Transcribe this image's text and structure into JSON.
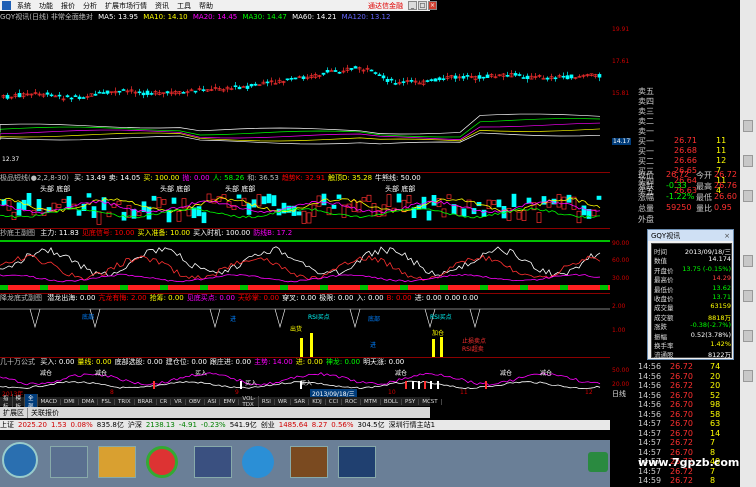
{
  "menu": {
    "items": [
      "系统",
      "功能",
      "报价",
      "分析",
      "扩展市场行情",
      "资讯",
      "工具",
      "帮助"
    ],
    "brand": "通达信金融"
  },
  "window_buttons": [
    "_",
    "□",
    "×"
  ],
  "main_title": {
    "text": "GQY视讯(日线) 非常全面绝对",
    "ma": [
      {
        "label": "MA5: 13.95",
        "color": "#ffffff"
      },
      {
        "label": "MA10: 14.10",
        "color": "#ffff00"
      },
      {
        "label": "MA20: 14.45",
        "color": "#ff00ff"
      },
      {
        "label": "MA30: 14.47",
        "color": "#00ff00"
      },
      {
        "label": "MA60: 14.21",
        "color": "#ffffff"
      },
      {
        "label": "MA120: 13.12",
        "color": "#4040ff"
      }
    ]
  },
  "price_axis": [
    "19.91",
    "17.61",
    "15.81",
    "14.17",
    "12.37"
  ],
  "panel2": {
    "title": "极品短线(●2,2,8-30)",
    "items": [
      {
        "label": "买: 13.49",
        "color": "#ffffff"
      },
      {
        "label": "卖: 14.05",
        "color": "#ffffff"
      },
      {
        "label": "买: 100.00",
        "color": "#ffff00"
      },
      {
        "label": "抛: 0.00",
        "color": "#ff00ff"
      },
      {
        "label": "人: 58.26",
        "color": "#00ff00"
      },
      {
        "label": "和: 36.53",
        "color": "#c0c0c0"
      },
      {
        "label": "趋势K: 32.91",
        "color": "#ff0000"
      },
      {
        "label": "触顶D: 35.28",
        "color": "#ffff00"
      },
      {
        "label": "牛熊线: 50.00",
        "color": "#ffffff"
      }
    ],
    "labels": [
      "头部 底部",
      "头部 底部",
      "头部 底部",
      "头部 底部"
    ],
    "axis": [
      "",
      "",
      ""
    ]
  },
  "panel3": {
    "title": "抄底王副图",
    "items": [
      {
        "label": "主力: 11.83",
        "color": "#ffffff"
      },
      {
        "label": "见底信号: 10.00",
        "color": "#ff0000"
      },
      {
        "label": "买入准备: 10.00",
        "color": "#ffff00"
      },
      {
        "label": "买入时机: 100.00",
        "color": "#ffffff"
      },
      {
        "label": "防线B: 17.2",
        "color": "#ff00ff"
      }
    ],
    "axis": [
      "90.00",
      "60.00",
      "30.00"
    ]
  },
  "panel4": {
    "title": "降龙底式副图",
    "items": [
      {
        "label": "潜龙出海: 0.00",
        "color": "#ffffff"
      },
      {
        "label": "亢龙有悔: 2.00",
        "color": "#ff0000"
      },
      {
        "label": "抢筹: 0.00",
        "color": "#ffff00"
      },
      {
        "label": "见底买点: 0.00",
        "color": "#ff00ff"
      },
      {
        "label": "天砂掌: 0.00",
        "color": "#ff0000"
      },
      {
        "label": "穿叉: 0.00",
        "color": "#ffffff"
      },
      {
        "label": "极限: 0.00",
        "color": "#ffffff"
      },
      {
        "label": "入: 0.00",
        "color": "#ffffff"
      },
      {
        "label": "B: 0.00",
        "color": "#ff0000"
      },
      {
        "label": "进: 0.00",
        "color": "#ffffff"
      },
      {
        "label": "0.00 0.00",
        "color": "#ffffff"
      }
    ],
    "labels": [
      "RSI买点",
      "RSI买点",
      "出货",
      "底部",
      "进",
      "底部",
      "加仓",
      "进",
      "RSI超卖",
      "止损卖点"
    ],
    "axis": [
      "2.00",
      "1.00"
    ]
  },
  "panel5": {
    "title": "几十万公式",
    "items": [
      {
        "label": "买入: 0.00",
        "color": "#ffffff"
      },
      {
        "label": "量线: 0.00",
        "color": "#ffff00"
      },
      {
        "label": "底部选股: 0.00",
        "color": "#ffffff"
      },
      {
        "label": "建仓位: 0.00",
        "color": "#ffffff"
      },
      {
        "label": "跟庄进: 0.00",
        "color": "#ffffff"
      },
      {
        "label": "主势: 14.00",
        "color": "#ff00ff"
      },
      {
        "label": "进: 0.00",
        "color": "#ffff00"
      },
      {
        "label": "神龙: 0.00",
        "color": "#00ff00"
      },
      {
        "label": "明天涨: 0.00",
        "color": "#ffffff"
      }
    ],
    "labels": [
      "减仓",
      "减仓",
      "买入",
      "减仓",
      "买入",
      "买入",
      "减仓",
      "减仓"
    ],
    "axis": [
      "50.00",
      "20.00"
    ]
  },
  "date_bar": {
    "year": "2013年",
    "marks": [
      "8",
      "9",
      "10",
      "11",
      "12"
    ],
    "current_date": "2013/09/18/三",
    "period": "日线"
  },
  "indicator_tabs": [
    "指标",
    "模板",
    "全部",
    "MACD",
    "DMI",
    "DMA",
    "FSL",
    "TRIX",
    "BRAR",
    "CR",
    "VR",
    "OBV",
    "ASI",
    "EMV",
    "VOL-TDX",
    "RSI",
    "WR",
    "SAR",
    "KDJ",
    "CCI",
    "ROC",
    "MTM",
    "BOLL",
    "PSY",
    "MCST"
  ],
  "sub_tabs": [
    "扩展区",
    "关联报价"
  ],
  "status_bar": [
    {
      "label": "上证",
      "color": "#000000"
    },
    {
      "label": "2025.20",
      "color": "#d00000"
    },
    {
      "label": "1.53",
      "color": "#d00000"
    },
    {
      "label": "0.08%",
      "color": "#d00000"
    },
    {
      "label": "835.8亿",
      "color": "#000000"
    },
    {
      "label": "沪深",
      "color": "#000000"
    },
    {
      "label": "2138.13",
      "color": "#008000"
    },
    {
      "label": "-4.91",
      "color": "#008000"
    },
    {
      "label": "-0.23%",
      "color": "#008000"
    },
    {
      "label": "541.9亿",
      "color": "#000000"
    },
    {
      "label": "创业",
      "color": "#000000"
    },
    {
      "label": "1485.64",
      "color": "#d00000"
    },
    {
      "label": "8.27",
      "color": "#d00000"
    },
    {
      "label": "0.56%",
      "color": "#d00000"
    },
    {
      "label": "304.5亿",
      "color": "#000000"
    },
    {
      "label": "深圳行情主站1",
      "color": "#000000"
    }
  ],
  "order_book": [
    {
      "label": "卖五",
      "price": "",
      "vol": ""
    },
    {
      "label": "卖四",
      "price": "",
      "vol": ""
    },
    {
      "label": "卖三",
      "price": "",
      "vol": ""
    },
    {
      "label": "卖二",
      "price": "",
      "vol": ""
    },
    {
      "label": "卖一",
      "price": "",
      "vol": ""
    },
    {
      "label": "买一",
      "price": "26.68",
      "vol": "11"
    },
    {
      "label": "买二",
      "price": "26.66",
      "vol": "12"
    },
    {
      "label": "买三",
      "price": "26.65",
      "vol": "7"
    },
    {
      "label": "买四",
      "price": "26.64",
      "vol": "11"
    },
    {
      "label": "买五",
      "price": "26.63",
      "vol": "4"
    }
  ],
  "order_book_first": {
    "label": "买一",
    "price": "26.71",
    "vol": "11"
  },
  "summary": [
    {
      "label": "现价",
      "value": "26.72",
      "label2": "今开",
      "value2": "26.72"
    },
    {
      "label": "涨跌",
      "value": "-0.33",
      "label2": "最高",
      "value2": "26.76"
    },
    {
      "label": "涨幅",
      "value": "-1.22%",
      "label2": "最低",
      "value2": "26.60"
    },
    {
      "label": "总量",
      "value": "59250",
      "label2": "量比",
      "value2": "0.95"
    },
    {
      "label": "外盘",
      "value": "",
      "label2": "",
      "value2": ""
    }
  ],
  "ticks": [
    {
      "time": "14:56",
      "price": "26.72",
      "vol": "74"
    },
    {
      "time": "14:56",
      "price": "26.70",
      "vol": "20"
    },
    {
      "time": "14:56",
      "price": "26.72",
      "vol": "20"
    },
    {
      "time": "14:56",
      "price": "26.70",
      "vol": "52"
    },
    {
      "time": "14:56",
      "price": "26.70",
      "vol": "98"
    },
    {
      "time": "14:56",
      "price": "26.70",
      "vol": "58"
    },
    {
      "time": "14:57",
      "price": "26.70",
      "vol": "63"
    },
    {
      "time": "14:57",
      "price": "26.70",
      "vol": "14"
    },
    {
      "time": "14:57",
      "price": "26.72",
      "vol": "7"
    },
    {
      "time": "14:57",
      "price": "26.70",
      "vol": "8"
    },
    {
      "time": "14:57",
      "price": "26.72",
      "vol": "49"
    },
    {
      "time": "14:57",
      "price": "26.72",
      "vol": "7"
    },
    {
      "time": "14:59",
      "price": "26.72",
      "vol": "8"
    }
  ],
  "popup": {
    "title": "GQY视讯",
    "rows": [
      {
        "label": "时间",
        "value": "2013/09/18/三",
        "color": "#ffffff"
      },
      {
        "label": "数值",
        "value": "14.174",
        "color": "#ffffff"
      },
      {
        "label": "开盘价",
        "value": "13.75 (-0.15%)",
        "color": "#00ff00"
      },
      {
        "label": "最高价",
        "value": "14.29",
        "color": "#ff4040"
      },
      {
        "label": "最低价",
        "value": "13.62",
        "color": "#00ff00"
      },
      {
        "label": "收盘价",
        "value": "13.71",
        "color": "#00ff00"
      },
      {
        "label": "成交量",
        "value": "63159",
        "color": "#ffff00"
      },
      {
        "label": "成交额",
        "value": "8818万",
        "color": "#ffff00"
      },
      {
        "label": "涨跌",
        "value": "-0.38(-2.7%)",
        "color": "#00ff00"
      },
      {
        "label": "振幅",
        "value": "0.52(3.78%)",
        "color": "#ffffff"
      },
      {
        "label": "换手率",
        "value": "1.42%",
        "color": "#ffff00"
      },
      {
        "label": "流通股",
        "value": "8122万",
        "color": "#ffffff"
      }
    ]
  },
  "watermark": "www.7gpzb.com"
}
